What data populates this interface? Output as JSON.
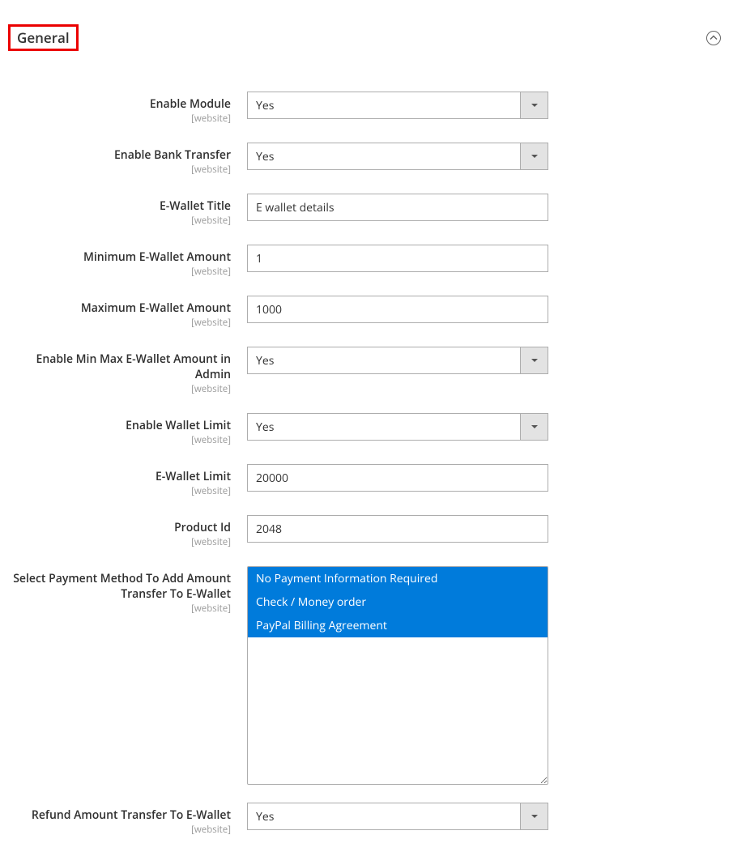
{
  "section": {
    "title": "General",
    "scope_text": "[website]"
  },
  "fields": {
    "enable_module": {
      "label": "Enable Module",
      "value": "Yes"
    },
    "enable_bank_transfer": {
      "label": "Enable Bank Transfer",
      "value": "Yes"
    },
    "ewallet_title": {
      "label": "E-Wallet Title",
      "value": "E wallet details"
    },
    "min_amount": {
      "label": "Minimum E-Wallet Amount",
      "value": "1"
    },
    "max_amount": {
      "label": "Maximum E-Wallet Amount",
      "value": "1000"
    },
    "enable_minmax_admin": {
      "label": "Enable Min Max E-Wallet Amount in Admin",
      "value": "Yes"
    },
    "enable_wallet_limit": {
      "label": "Enable Wallet Limit",
      "value": "Yes"
    },
    "ewallet_limit": {
      "label": "E-Wallet Limit",
      "value": "20000"
    },
    "product_id": {
      "label": "Product Id",
      "value": "2048"
    },
    "payment_method": {
      "label": "Select Payment Method To Add Amount Transfer To E-Wallet",
      "options": {
        "opt1": "No Payment Information Required",
        "opt2": "Check / Money order",
        "opt3": "PayPal Billing Agreement"
      }
    },
    "refund_transfer": {
      "label": "Refund Amount Transfer To E-Wallet",
      "value": "Yes"
    }
  }
}
